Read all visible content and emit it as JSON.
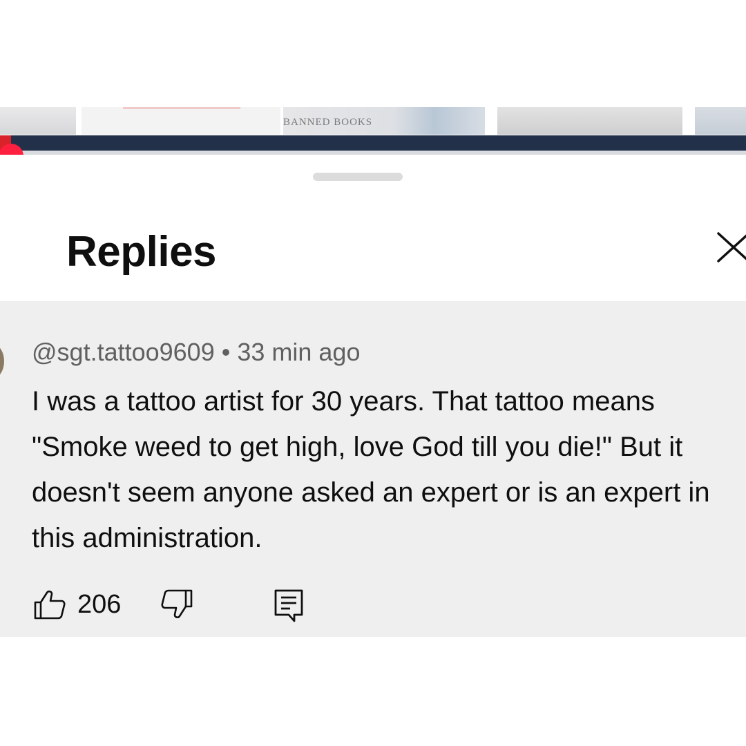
{
  "video": {
    "thumbnail_text": "BANNED BOOKS",
    "progress_fraction": 0.015
  },
  "sheet": {
    "title": "Replies"
  },
  "comment": {
    "author": "@sgt.tattoo9609",
    "separator": "•",
    "timestamp": "33 min ago",
    "text": "I was a tattoo artist for 30 years. That tattoo means \"Smoke weed to get high, love God till you die!\" But it doesn't seem anyone asked an expert or is an expert in this administration.",
    "like_count": "206"
  },
  "icons": {
    "close": "close-icon",
    "like": "thumb-up-icon",
    "dislike": "thumb-down-icon",
    "reply": "comment-icon"
  },
  "colors": {
    "progress_track": "#22304a",
    "progress_knob": "#ff1f3f",
    "comment_highlight": "#efefef"
  }
}
